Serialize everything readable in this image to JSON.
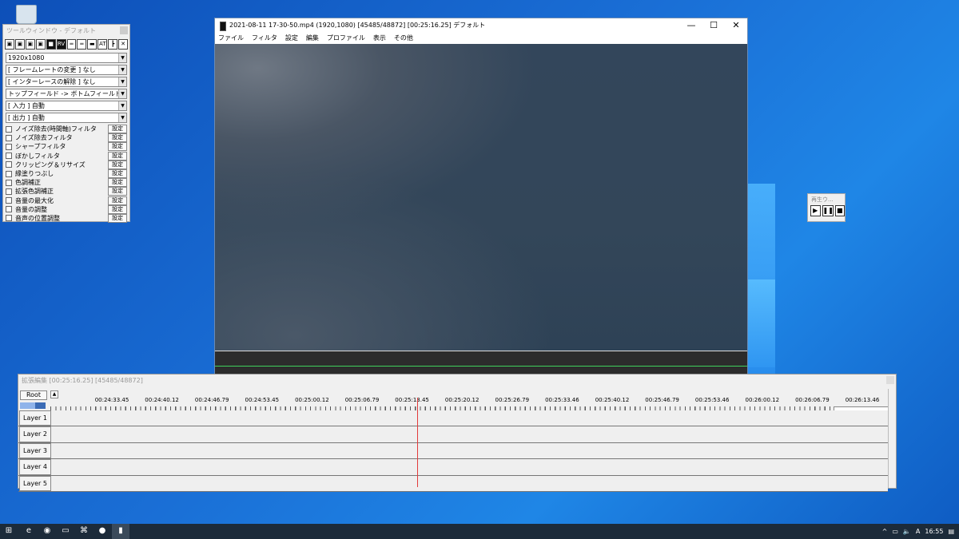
{
  "tool_window": {
    "title": "ツールウィンドウ - デフォルト",
    "icon_buttons": [
      "▣",
      "▣",
      "▣",
      "▣",
      "■",
      "RV",
      "═",
      "═",
      "▬",
      "AT",
      "┣",
      "✕"
    ],
    "dropdowns": [
      "1920x1080",
      "[ フレームレートの変更 ] なし",
      "[ インターレースの解除 ] なし",
      "トップフィールド -> ボトムフィールド",
      "[ 入力 ] 自動",
      "[ 出力 ] 自動"
    ],
    "filters": [
      {
        "label": "ノイズ除去(時間軸)フィルタ",
        "button": "設定"
      },
      {
        "label": "ノイズ除去フィルタ",
        "button": "設定"
      },
      {
        "label": "シャープフィルタ",
        "button": "設定"
      },
      {
        "label": "ぼかしフィルタ",
        "button": "設定"
      },
      {
        "label": "クリッピング＆リサイズ",
        "button": "設定"
      },
      {
        "label": "縁塗りつぶし",
        "button": "設定"
      },
      {
        "label": "色調補正",
        "button": "設定"
      },
      {
        "label": "拡張色調補正",
        "button": "設定"
      },
      {
        "label": "音量の最大化",
        "button": "設定"
      },
      {
        "label": "音量の調整",
        "button": "設定"
      },
      {
        "label": "音声の位置調整",
        "button": "設定"
      }
    ]
  },
  "main_window": {
    "title": "2021-08-11 17-30-50.mp4 (1920,1080)  [45485/48872] [00:25:16.25]  デフォルト",
    "controls": {
      "minimize": "—",
      "maximize": "☐",
      "close": "✕"
    },
    "menu": [
      "ファイル",
      "フィルタ",
      "設定",
      "編集",
      "プロファイル",
      "表示",
      "その他"
    ]
  },
  "play_window": {
    "title": "再生ウ...",
    "buttons": [
      "▶",
      "❚❚",
      "■"
    ]
  },
  "timeline": {
    "title": "拡張編集 [00:25:16.25] [45485/48872]",
    "root_label": "Root",
    "small_button": "▲",
    "time_labels": [
      "00:24:33.45",
      "00:24:40.12",
      "00:24:46.79",
      "00:24:53.45",
      "00:25:00.12",
      "00:25:06.79",
      "00:25:13.45",
      "00:25:20.12",
      "00:25:26.79",
      "00:25:33.46",
      "00:25:40.12",
      "00:25:46.79",
      "00:25:53.46",
      "00:26:00.12",
      "00:26:06.79",
      "00:26:13.46"
    ],
    "layers": [
      "Layer 1",
      "Layer 2",
      "Layer 3",
      "Layer 4",
      "Layer 5"
    ]
  },
  "taskbar": {
    "start_icon": "⊞",
    "apps": [
      "edge-icon",
      "chrome-icon",
      "explorer-icon",
      "vscode-icon",
      "ppt-icon",
      "aviutl-icon"
    ],
    "app_glyphs": [
      "e",
      "◉",
      "▭",
      "⌘",
      "●",
      "▮"
    ],
    "tray_chevron": "^",
    "tray_network": "▭",
    "tray_volume": "🔈",
    "tray_ime": "A",
    "clock": "16:55",
    "notification": "▤"
  }
}
